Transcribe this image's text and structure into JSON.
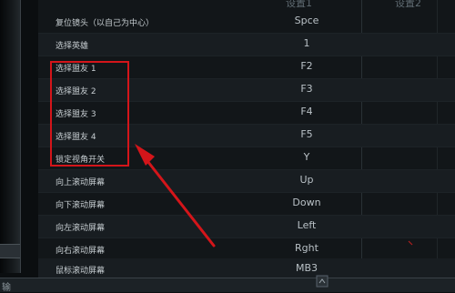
{
  "header": {
    "col1": "设置1",
    "col2": "设置2"
  },
  "rows": [
    {
      "label": "复位镜头（以自己为中心）",
      "key": "Spce"
    },
    {
      "label": "选择英雄",
      "key": "1"
    },
    {
      "label": "选择盟友 1",
      "key": "F2"
    },
    {
      "label": "选择盟友 2",
      "key": "F3"
    },
    {
      "label": "选择盟友 3",
      "key": "F4"
    },
    {
      "label": "选择盟友 4",
      "key": "F5"
    },
    {
      "label": "锁定视角开关",
      "key": "Y"
    },
    {
      "label": "向上滚动屏幕",
      "key": "Up"
    },
    {
      "label": "向下滚动屏幕",
      "key": "Down"
    },
    {
      "label": "向左滚动屏幕",
      "key": "Left"
    },
    {
      "label": "向右滚动屏幕",
      "key": "Rght"
    },
    {
      "label": "鼠标滚动屏幕",
      "key": "MB3"
    }
  ],
  "bottom": {
    "text": "输"
  },
  "colors": {
    "annotation": "#d4151a",
    "background": "#121619",
    "text": "#c6cdd1"
  }
}
